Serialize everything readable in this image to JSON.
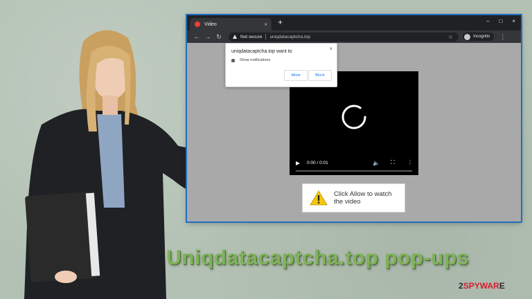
{
  "browser": {
    "tab_title": "Video",
    "tab_close": "×",
    "new_tab": "+",
    "window_controls": [
      "–",
      "□",
      "×"
    ],
    "nav": {
      "back": "←",
      "forward": "→",
      "reload": "↻"
    },
    "security_label": "Not secure",
    "url": "uniqdatacaptcha.top",
    "profile_label": "Incognito",
    "menu": "⋮"
  },
  "notification": {
    "title": "uniqdatacaptcha.top want to",
    "close": "×",
    "permission": "Show notifications",
    "allow_label": "Allow",
    "block_label": "Block"
  },
  "video": {
    "time": "0:00 / 0:01",
    "progress_percent": 0
  },
  "message": {
    "text": "Click Allow to watch the video"
  },
  "headline": "Uniqdatacaptcha.top pop-ups",
  "brand": {
    "prefix": "2",
    "accent": "SPYWAR",
    "suffix": "E"
  },
  "icons": [
    "favicon-icon",
    "warning-icon",
    "star-icon",
    "incognito-icon",
    "bell-icon",
    "play-icon",
    "volume-icon",
    "fullscreen-icon",
    "more-icon",
    "spinner-icon"
  ],
  "colors": {
    "headline": "#7fb35a",
    "link_blue": "#1a73e8",
    "warning_yellow": "#f4c70c",
    "brand_red": "#d21d2c"
  }
}
